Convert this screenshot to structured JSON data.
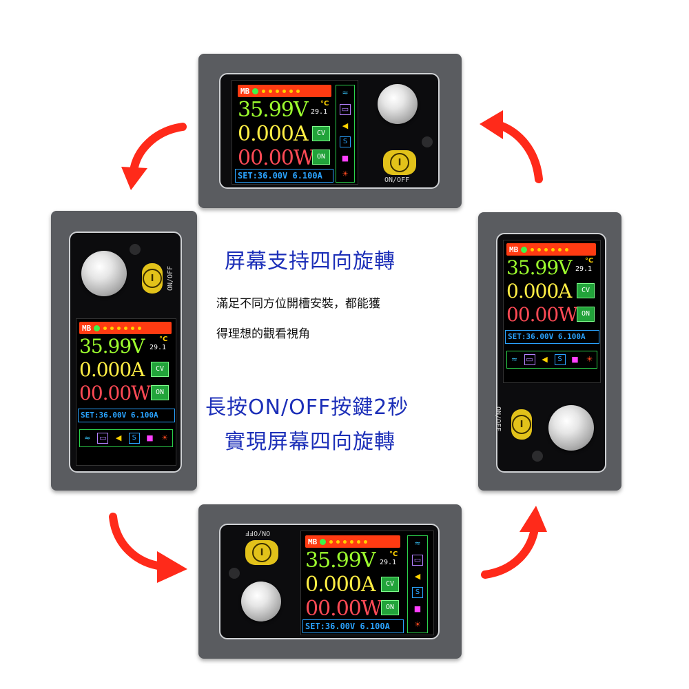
{
  "headline": "屏幕支持四向旋轉",
  "body_line1": "滿足不同方位開槽安裝，都能獲",
  "body_line2": "得理想的觀看視角",
  "instruction_line1": "長按ON/OFF按鍵2秒",
  "instruction_line2": "實現屏幕四向旋轉",
  "display": {
    "mb": "MB",
    "voltage": "35.99V",
    "current": "0.000A",
    "power": "00.00W",
    "temperature": "29.1",
    "temp_unit": "°C",
    "mode_cv": "CV",
    "mode_on": "ON",
    "set_line": "SET:36.00V 6.100A",
    "button_label": "ON/OFF",
    "power_glyph": "I"
  },
  "colors": {
    "headline": "#1c2fb8",
    "arrow": "#ff2a1a",
    "voltage": "#9dff2e",
    "current": "#ffee44",
    "power": "#ff4a55",
    "set": "#2aa3ff",
    "topbar": "#ff3b12"
  },
  "icon_names": [
    "wifi-icon",
    "memory-icon",
    "speaker-icon",
    "s-icon",
    "lock-icon",
    "sun-icon"
  ]
}
